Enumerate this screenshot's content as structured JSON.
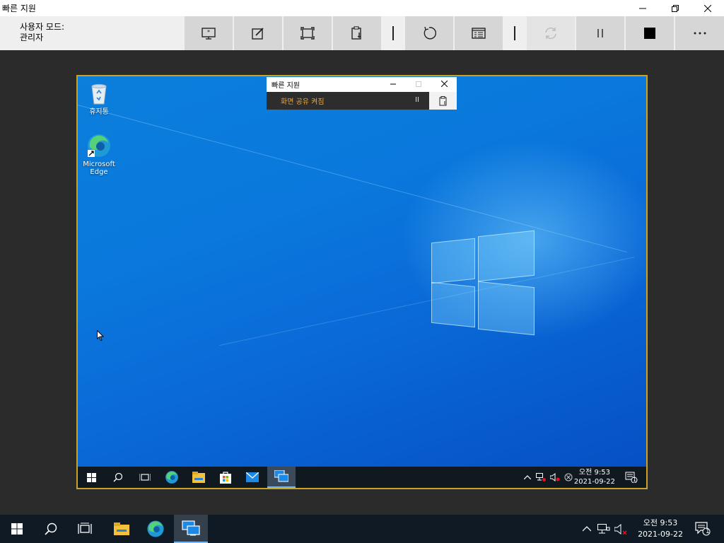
{
  "window": {
    "title": "빠른 지원"
  },
  "toolbar": {
    "mode_line1": "사용자 모드:",
    "mode_line2": "관리자"
  },
  "qa_window": {
    "title": "빠른 지원",
    "status": "화면 공유 켜짐",
    "pause_glyph": "II"
  },
  "remote_desktop": {
    "icons": [
      {
        "name": "recycle-bin",
        "label": "휴지통"
      },
      {
        "name": "microsoft-edge",
        "label": "Microsoft Edge"
      }
    ],
    "clock": {
      "time": "오전 9:53",
      "date": "2021-09-22"
    },
    "notification_count": "1"
  },
  "taskbar": {
    "clock": {
      "time": "오전 9:53",
      "date": "2021-09-22"
    },
    "notification_count": "1"
  },
  "colors": {
    "frame_border": "#c9a227",
    "status_text": "#f0a830",
    "taskbar": "#0f1a24"
  }
}
